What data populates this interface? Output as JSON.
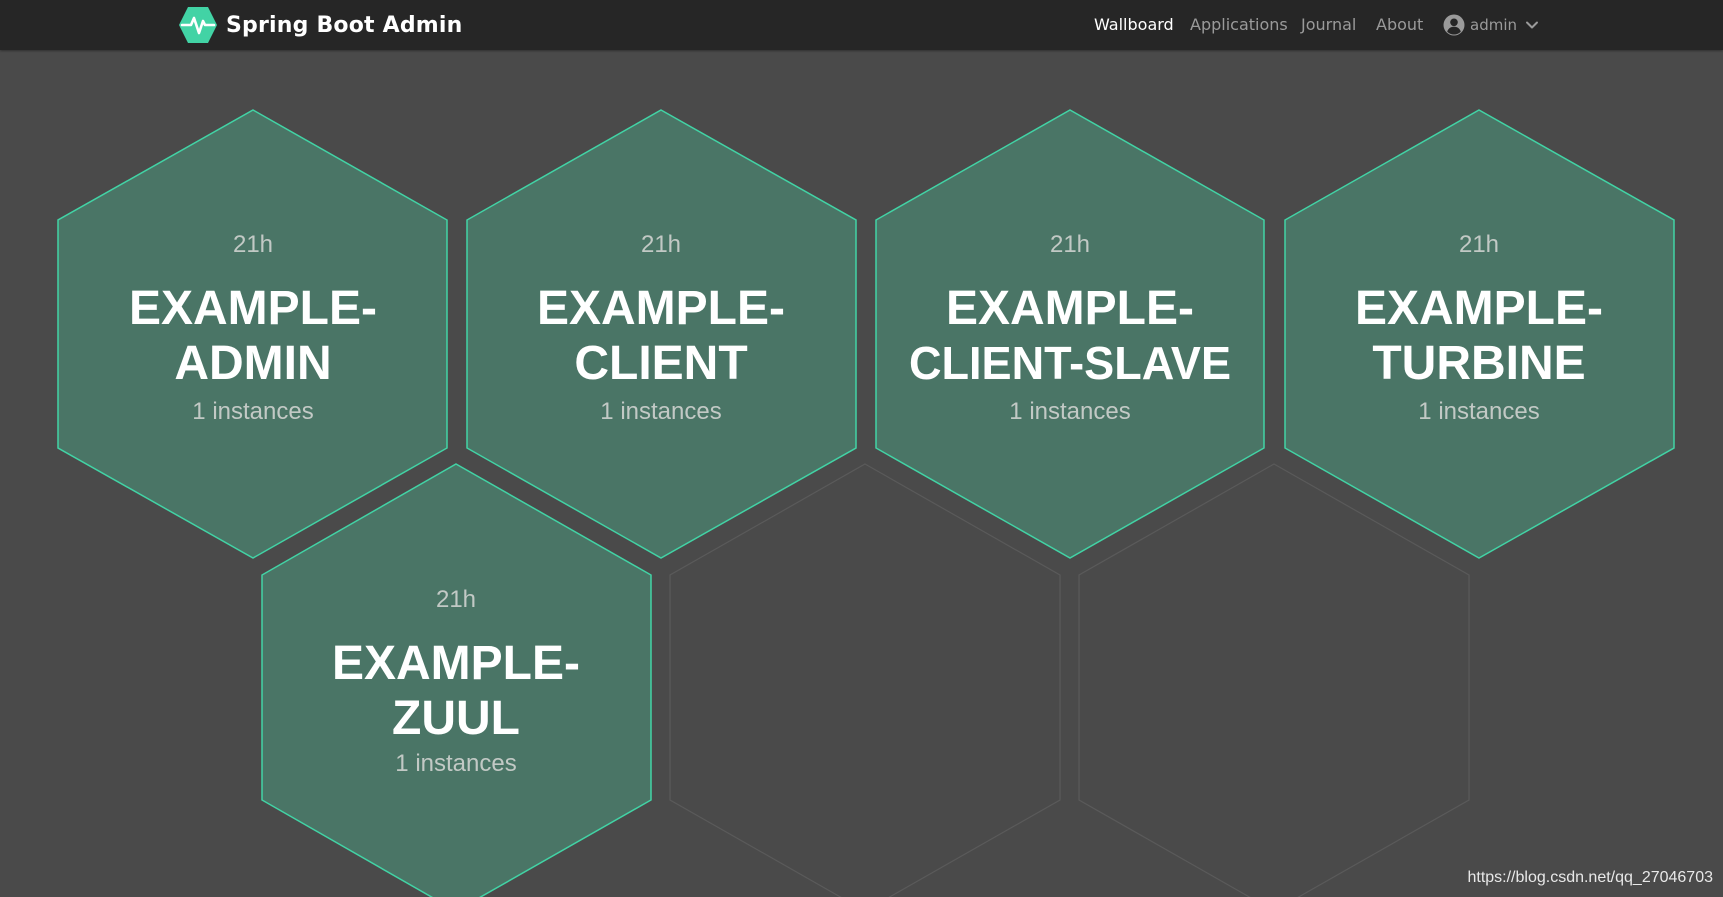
{
  "app": {
    "title": "Spring Boot Admin"
  },
  "nav": {
    "items": [
      {
        "label": "Wallboard",
        "active": true
      },
      {
        "label": "Applications",
        "active": false
      },
      {
        "label": "Journal",
        "active": false
      },
      {
        "label": "About",
        "active": false
      }
    ],
    "user": {
      "name": "admin",
      "icon": "user-circle-icon",
      "caret_icon": "chevron-down-icon"
    }
  },
  "colors": {
    "navbar_bg": "#262626",
    "page_bg": "#4a4a4a",
    "tile_fill": "#4a7566",
    "tile_border": "#42d3a5",
    "empty_tile_border": "#5a5a5a",
    "brand_accent": "#42d3a5"
  },
  "applications": [
    {
      "name_line1": "EXAMPLE-",
      "name_line2": "ADMIN",
      "uptime": "21h",
      "instances": "1 instances"
    },
    {
      "name_line1": "EXAMPLE-",
      "name_line2": "CLIENT",
      "uptime": "21h",
      "instances": "1 instances"
    },
    {
      "name_line1": "EXAMPLE-",
      "name_line2": "CLIENT-SLAVE",
      "uptime": "21h",
      "instances": "1 instances"
    },
    {
      "name_line1": "EXAMPLE-",
      "name_line2": "TURBINE",
      "uptime": "21h",
      "instances": "1 instances"
    },
    {
      "name_line1": "EXAMPLE-",
      "name_line2": "ZUUL",
      "uptime": "21h",
      "instances": "1 instances"
    }
  ],
  "watermark": "https://blog.csdn.net/qq_27046703"
}
